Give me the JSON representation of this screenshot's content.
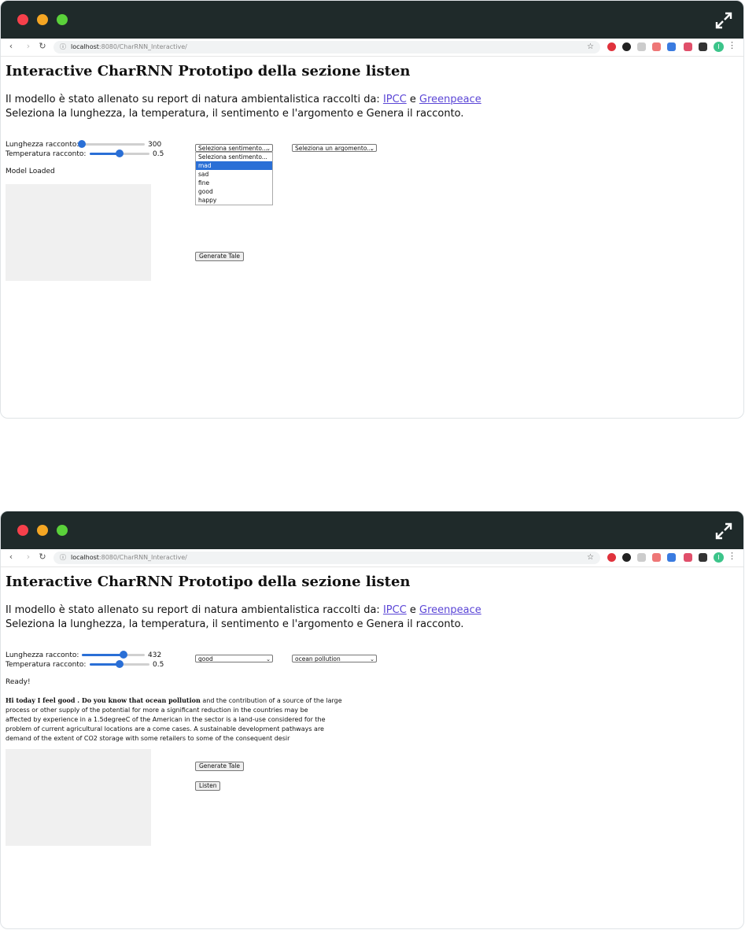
{
  "browser": {
    "url_host": "localhost",
    "url_path": ":8080/CharRNN_Interactive/",
    "avatar_initial": "I"
  },
  "page": {
    "title": "Interactive CharRNN Prototipo della sezione listen",
    "intro_prefix": "Il modello è stato allenato su report di natura ambientalistica raccolti da: ",
    "link_ipcc": "IPCC",
    "conj": " e ",
    "link_greenpeace": "Greenpeace",
    "intro_line2": "Seleziona la lunghezza, la temperatura, il sentimento e l'argomento e Genera il racconto.",
    "length_label": "Lunghezza racconto:",
    "temperature_label": "Temperatura racconto:",
    "generate_button": "Generate Tale",
    "listen_button": "Listen"
  },
  "screen1": {
    "length_value": "300",
    "temperature_value": "0.5",
    "length_fraction": 0.0,
    "temperature_fraction": 0.5,
    "status": "Model Loaded",
    "sentiment_selected": "Seleziona sentimento...",
    "topic_selected": "Seleziona un argomento...",
    "sentiment_options": [
      "Seleziona sentimento...",
      "mad",
      "sad",
      "fine",
      "good",
      "happy"
    ],
    "highlighted_option": "mad"
  },
  "screen2": {
    "length_value": "432",
    "temperature_value": "0.5",
    "length_fraction": 0.66,
    "temperature_fraction": 0.5,
    "status": "Ready!",
    "sentiment_selected": "good",
    "topic_selected": "ocean pollution",
    "story_lead": "Hi today I feel good . Do you know that ocean pollution",
    "story_lines": [
      " and the contribution of a source of the large",
      "process or other supply of the potential for more a significant reduction in the countries may be",
      "affected by experience in a 1.5degreeC of the American in the sector is a land-use considered for the",
      "problem of current agricultural locations are a come cases. A sustainable development pathways are",
      "demand of the extent of CO2 storage with some retailers to some of the consequent desir"
    ]
  },
  "colors": {
    "titlebar": "#1f2a2a",
    "accent": "#2a6fd6",
    "link": "#5b46d6"
  },
  "icons": [
    "chevron-left-icon",
    "chevron-right-icon",
    "reload-icon",
    "info-icon",
    "star-icon",
    "expand-icon",
    "menu-dots-icon"
  ]
}
